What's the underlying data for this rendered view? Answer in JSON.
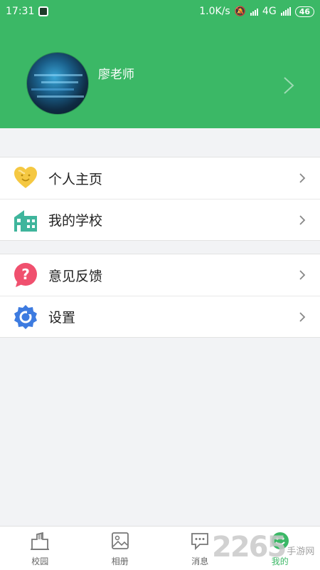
{
  "status_bar": {
    "time": "17:31",
    "network_speed": "1.0K/s",
    "network_type": "4G",
    "battery": "46"
  },
  "profile": {
    "name": "廖老师"
  },
  "menu": {
    "group1": [
      {
        "label": "个人主页",
        "icon": "heart-smile-icon"
      },
      {
        "label": "我的学校",
        "icon": "school-building-icon"
      }
    ],
    "group2": [
      {
        "label": "意见反馈",
        "icon": "question-bubble-icon"
      },
      {
        "label": "设置",
        "icon": "settings-gear-icon"
      }
    ]
  },
  "bottom_nav": [
    {
      "label": "校园",
      "icon": "campus-icon",
      "active": false
    },
    {
      "label": "相册",
      "icon": "album-icon",
      "active": false
    },
    {
      "label": "消息",
      "icon": "message-icon",
      "active": false
    },
    {
      "label": "我的",
      "icon": "profile-smile-icon",
      "active": true
    }
  ],
  "watermark": {
    "number": "2265",
    "text": "手游网"
  },
  "colors": {
    "brand_green": "#3bb866",
    "background": "#f2f3f5",
    "heart_yellow": "#f5c842",
    "school_teal": "#3fb59c",
    "feedback_red": "#f0506e",
    "settings_blue": "#3d7be0"
  }
}
